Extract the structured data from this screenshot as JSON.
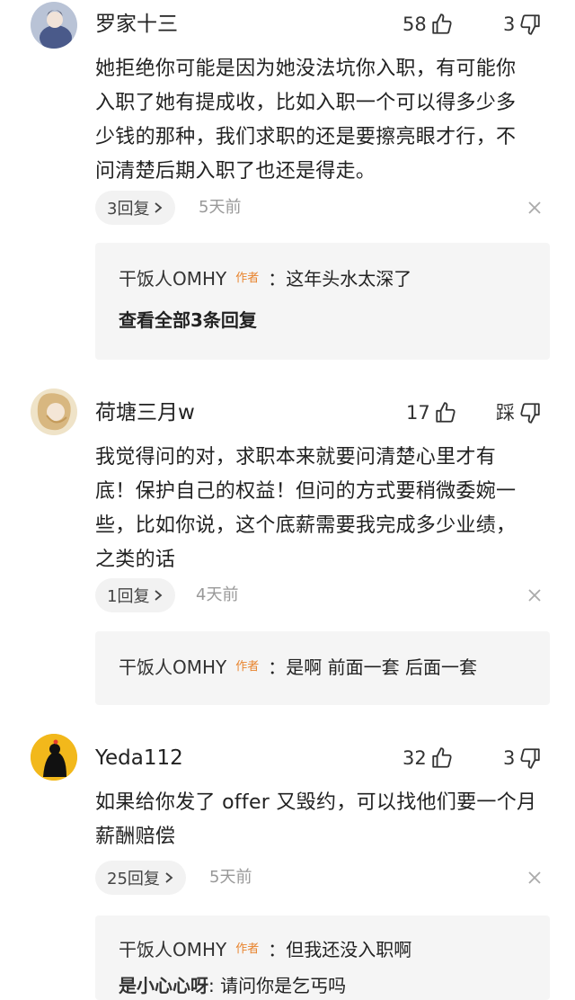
{
  "comments": [
    {
      "username": "罗家十三",
      "likes": "58",
      "dislikes": "3",
      "text": "她拒绝你可能是因为她没法坑你入职，有可能你\n入职了她有提成收，比如入职一个可以得多少多\n少钱的那种，我们求职的还是要擦亮眼才行，不\n问清楚后期入职了也还是得走。",
      "reply_count": "3回复",
      "time": "5天前",
      "replies": [
        {
          "author": "干饭人OMHY",
          "tag": "作者",
          "text": "：这年头水太深了"
        }
      ],
      "view_all": "查看全部3条回复"
    },
    {
      "username": "荷塘三月w",
      "likes": "17",
      "dislikes": "踩",
      "text": "我觉得问的对，求职本来就要问清楚心里才有\n底！保护自己的权益！但问的方式要稍微委婉一\n些，比如你说，这个底薪需要我完成多少业绩，\n之类的话",
      "reply_count": "1回复",
      "time": "4天前",
      "replies": [
        {
          "author": "干饭人OMHY",
          "tag": "作者",
          "text": "：是啊 前面一套 后面一套"
        }
      ]
    },
    {
      "username": "Yeda112",
      "likes": "32",
      "dislikes": "3",
      "text": "如果给你发了 offer 又毁约，可以找他们要一个月\n薪酬赔偿",
      "reply_count": "25回复",
      "time": "5天前",
      "replies": [
        {
          "author": "干饭人OMHY",
          "tag": "作者",
          "text": "：但我还没入职啊"
        },
        {
          "author": "是小心心呀",
          "tag": "",
          "text": ": 请问你是乞丐吗"
        }
      ]
    }
  ],
  "icons": {
    "thumb_up": "thumbs-up-icon",
    "thumb_down": "thumbs-down-icon",
    "chevron": "chevron-right-icon",
    "close": "close-icon"
  }
}
